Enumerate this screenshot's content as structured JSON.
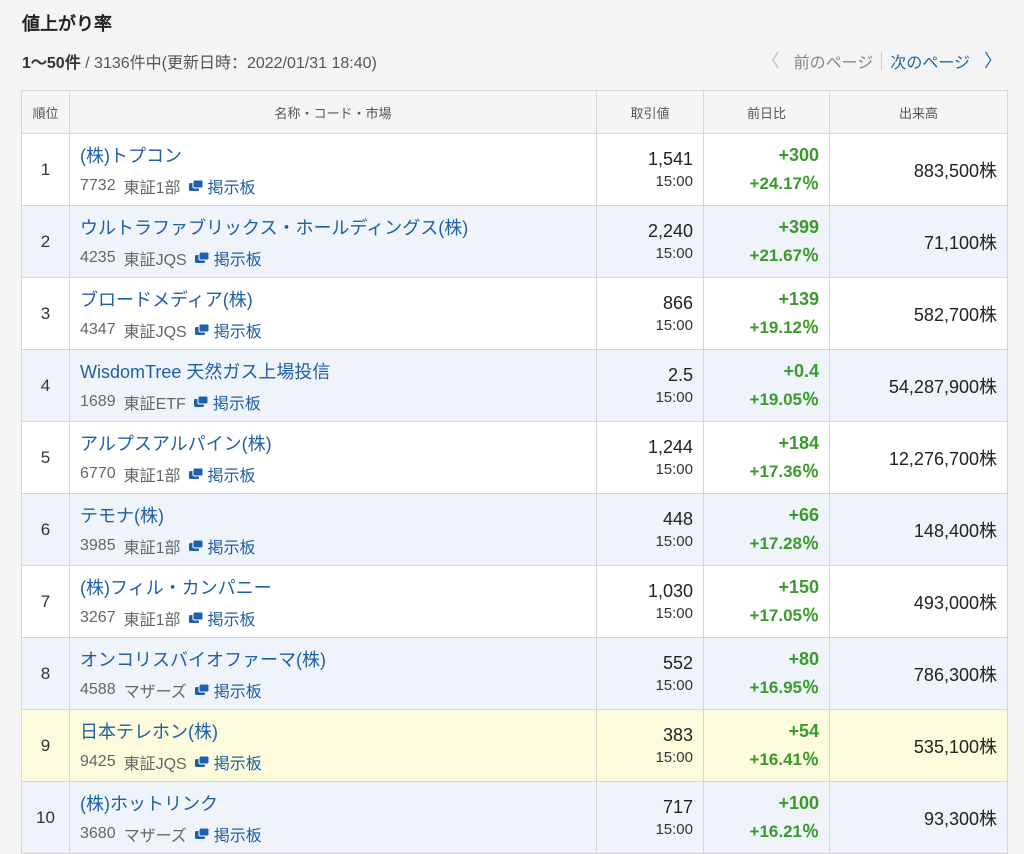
{
  "header": {
    "title": "値上がり率",
    "summary_range": "1〜50件",
    "summary_rest": " / 3136件中(更新日時：2022/01/31 18:40)",
    "prev_label": "前のページ",
    "next_label": "次のページ"
  },
  "columns": {
    "rank": "順位",
    "name": "名称・コード・市場",
    "price": "取引値",
    "change": "前日比",
    "volume": "出来高"
  },
  "board_label": "掲示板",
  "colors": {
    "link": "#1f5fa8",
    "up": "#3a9a2a",
    "highlight": "#fcfbdb"
  },
  "rows": [
    {
      "rank": "1",
      "name": "(株)トプコン",
      "code": "7732",
      "market": "東証1部",
      "price": "1,541",
      "time": "15:00",
      "chg": "+300",
      "pct": "+24.17％",
      "volume": "883,500株"
    },
    {
      "rank": "2",
      "name": "ウルトラファブリックス・ホールディングス(株)",
      "code": "4235",
      "market": "東証JQS",
      "price": "2,240",
      "time": "15:00",
      "chg": "+399",
      "pct": "+21.67％",
      "volume": "71,100株"
    },
    {
      "rank": "3",
      "name": "ブロードメディア(株)",
      "code": "4347",
      "market": "東証JQS",
      "price": "866",
      "time": "15:00",
      "chg": "+139",
      "pct": "+19.12％",
      "volume": "582,700株"
    },
    {
      "rank": "4",
      "name": "WisdomTree 天然ガス上場投信",
      "code": "1689",
      "market": "東証ETF",
      "price": "2.5",
      "time": "15:00",
      "chg": "+0.4",
      "pct": "+19.05％",
      "volume": "54,287,900株"
    },
    {
      "rank": "5",
      "name": "アルプスアルパイン(株)",
      "code": "6770",
      "market": "東証1部",
      "price": "1,244",
      "time": "15:00",
      "chg": "+184",
      "pct": "+17.36％",
      "volume": "12,276,700株"
    },
    {
      "rank": "6",
      "name": "テモナ(株)",
      "code": "3985",
      "market": "東証1部",
      "price": "448",
      "time": "15:00",
      "chg": "+66",
      "pct": "+17.28％",
      "volume": "148,400株"
    },
    {
      "rank": "7",
      "name": "(株)フィル・カンパニー",
      "code": "3267",
      "market": "東証1部",
      "price": "1,030",
      "time": "15:00",
      "chg": "+150",
      "pct": "+17.05％",
      "volume": "493,000株"
    },
    {
      "rank": "8",
      "name": "オンコリスバイオファーマ(株)",
      "code": "4588",
      "market": "マザーズ",
      "price": "552",
      "time": "15:00",
      "chg": "+80",
      "pct": "+16.95％",
      "volume": "786,300株"
    },
    {
      "rank": "9",
      "name": "日本テレホン(株)",
      "code": "9425",
      "market": "東証JQS",
      "price": "383",
      "time": "15:00",
      "chg": "+54",
      "pct": "+16.41％",
      "volume": "535,100株"
    },
    {
      "rank": "10",
      "name": "(株)ホットリンク",
      "code": "3680",
      "market": "マザーズ",
      "price": "717",
      "time": "15:00",
      "chg": "+100",
      "pct": "+16.21％",
      "volume": "93,300株"
    }
  ]
}
